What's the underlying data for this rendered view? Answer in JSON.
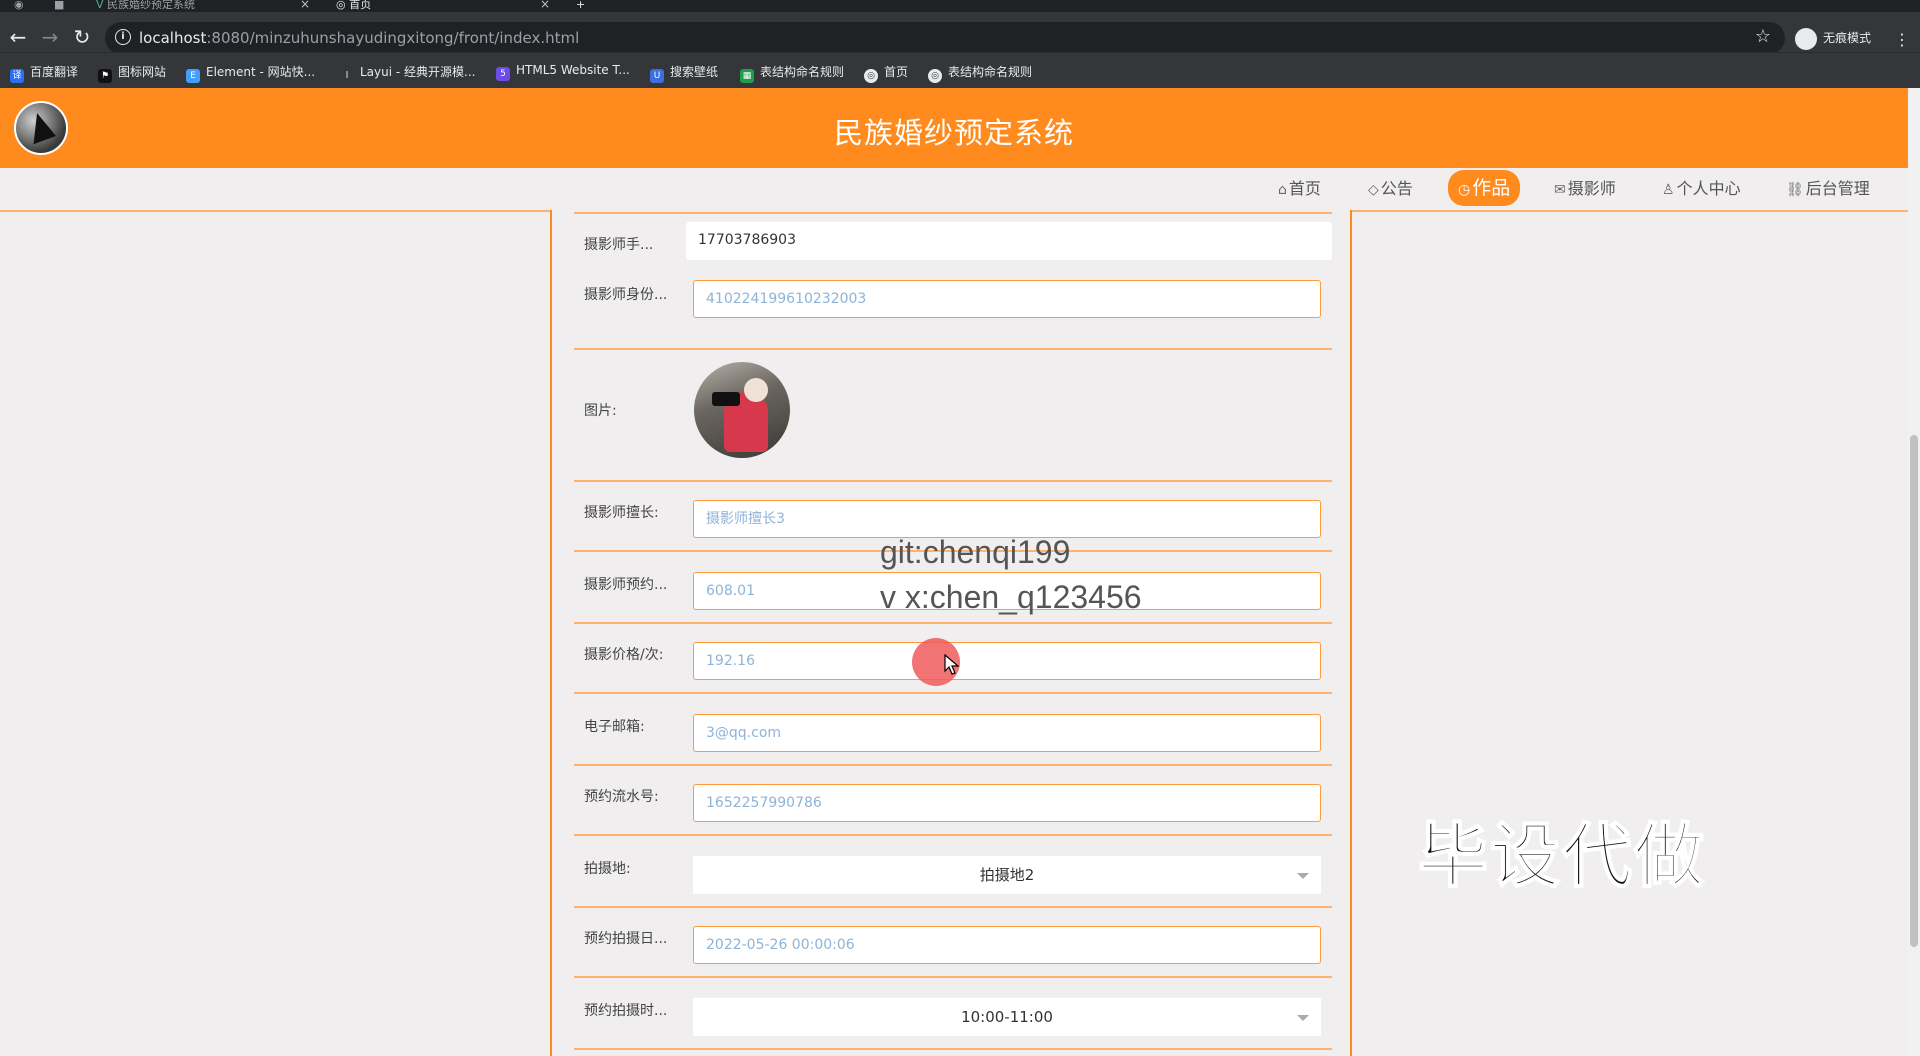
{
  "browser": {
    "tabs": [
      {
        "title": "民族婚纱预定系统",
        "close": "×"
      },
      {
        "title": "首页",
        "close": "×"
      }
    ],
    "new_tab": "+",
    "url_host": "localhost",
    "url_rest": ":8080/minzuhunshayudingxitong/front/index.html",
    "profile_label": "无痕模式",
    "bookmarks": [
      {
        "label": "百度翻译",
        "icon": "translate-icon",
        "color": "#2b6ff3"
      },
      {
        "label": "图标网站",
        "icon": "flag-icon",
        "color": "#111111"
      },
      {
        "label": "Element - 网站快...",
        "icon": "element-icon",
        "color": "#409eff"
      },
      {
        "label": "Layui - 经典开源模...",
        "icon": "layui-icon",
        "color": "#35363a"
      },
      {
        "label": "HTML5 Website T...",
        "icon": "html5-icon",
        "color": "#6b4ce6"
      },
      {
        "label": "搜索壁纸",
        "icon": "wallpaper-icon",
        "color": "#3d6ee0"
      },
      {
        "label": "表结构命名规则",
        "icon": "sheet-icon",
        "color": "#1e9e4a"
      },
      {
        "label": "首页",
        "icon": "globe-icon",
        "color": "#e8eaed"
      },
      {
        "label": "表结构命名规则",
        "icon": "globe-icon",
        "color": "#e8eaed"
      }
    ]
  },
  "site": {
    "title": "民族婚纱预定系统",
    "nav": [
      {
        "icon": "⌂",
        "label": "首页",
        "active": false
      },
      {
        "icon": "◇",
        "label": "公告",
        "active": false
      },
      {
        "icon": "◷",
        "label": "作品",
        "active": true
      },
      {
        "icon": "✉",
        "label": "摄影师",
        "active": false
      },
      {
        "icon": "♙",
        "label": "个人中心",
        "active": false
      },
      {
        "icon": "⛓",
        "label": "后台管理",
        "active": false
      }
    ]
  },
  "form": {
    "phone": {
      "label": "摄影师手...",
      "value": "17703786903"
    },
    "id_card": {
      "label": "摄影师身份...",
      "value": "410224199610232003"
    },
    "image": {
      "label": "图片:"
    },
    "specialty": {
      "label": "摄影师擅长:",
      "value": "摄影师擅长3"
    },
    "booking": {
      "label": "摄影师预约...",
      "value": "608.01"
    },
    "price": {
      "label": "摄影价格/次:",
      "value": "192.16"
    },
    "email": {
      "label": "电子邮箱:",
      "value": "3@qq.com"
    },
    "serial": {
      "label": "预约流水号:",
      "value": "1652257990786"
    },
    "location": {
      "label": "拍摄地:",
      "value": "拍摄地2"
    },
    "date": {
      "label": "预约拍摄日...",
      "value": "2022-05-26 00:00:06"
    },
    "time": {
      "label": "预约拍摄时...",
      "value": "10:00-11:00"
    }
  },
  "overlay": {
    "git": "git:chenqi199",
    "vx": "v x:chen_q123456",
    "ad": "毕设代做"
  },
  "colors": {
    "accent": "#ff8b1f",
    "accent_light": "#ffb26b",
    "placeholder_text": "#8db4d8"
  }
}
